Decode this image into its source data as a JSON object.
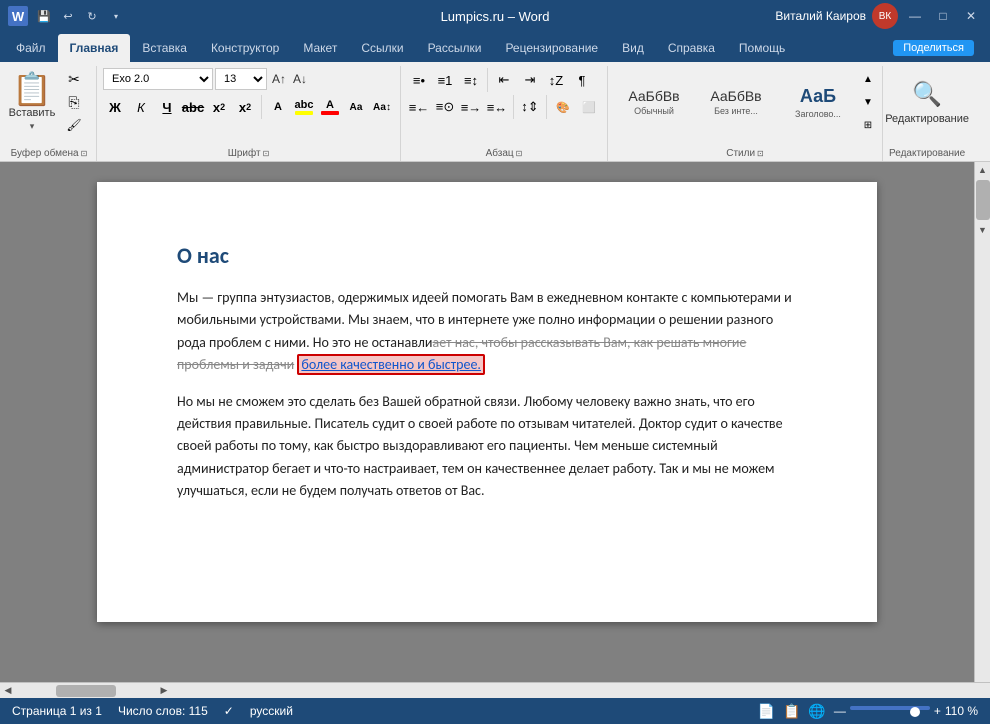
{
  "titleBar": {
    "appIcon": "W",
    "quickAccess": [
      "💾",
      "↩",
      "↻"
    ],
    "title": "Lumpics.ru – Word",
    "userName": "Виталий Каиров",
    "avatarText": "ВК",
    "winBtns": [
      "🗔",
      "—",
      "□",
      "✕"
    ]
  },
  "ribbonTabs": {
    "tabs": [
      "Файл",
      "Главная",
      "Вставка",
      "Конструктор",
      "Макет",
      "Ссылки",
      "Рассылки",
      "Рецензирование",
      "Вид",
      "Справка",
      "Помощь",
      "Поделиться"
    ],
    "activeTab": "Главная"
  },
  "ribbon": {
    "groups": [
      {
        "label": "Буфер обмена",
        "items": [
          "Вставить",
          "Вырезать",
          "Копировать",
          "Форматирование"
        ]
      },
      {
        "label": "Шрифт",
        "font": "Exo 2.0",
        "size": "13"
      },
      {
        "label": "Абзац"
      },
      {
        "label": "Стили",
        "styles": [
          {
            "name": "Обычный",
            "preview": "АаБбВв"
          },
          {
            "name": "Без инте...",
            "preview": "АаБбВв"
          },
          {
            "name": "Заголово...",
            "preview": "АаБ"
          }
        ]
      },
      {
        "label": "Редактирование",
        "btnLabel": "Редактирование"
      }
    ]
  },
  "document": {
    "title": "О нас",
    "paragraph1": "Мы — группа энтузиастов, одержимых идеей помогать Вам в ежедневном контакте с компьютерами и мобильными устройствами. Мы знаем, что в интернете уже полно информации о решении разного рода проблем с ними. Но это не останавли",
    "strikethrough": "ает нас, чтобы рассказывать Вам, как решать многие проблемы и задачи",
    "highlighted": "более качественно и быстрее.",
    "paragraph2": "Но мы не сможем это сделать без Вашей обратной связи. Любому человеку важно знать, что его действия правильные. Писатель судит о своей работе по отзывам читателей. Доктор судит о качестве своей работы по тому, как быстро выздоравливают его пациенты. Чем меньше системный администратор бегает и что-то настраивает, тем он качественнее делает работу. Так и мы не можем улучшаться, если не будем получать ответов от Вас."
  },
  "statusBar": {
    "page": "Страница 1 из 1",
    "wordCount": "Число слов: 115",
    "language": "русский",
    "zoom": "110 %"
  }
}
